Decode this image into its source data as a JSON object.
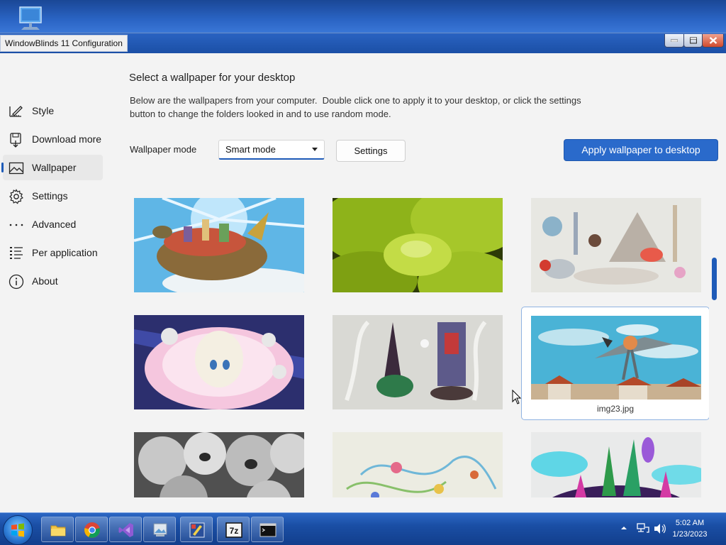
{
  "window": {
    "title": "WindowBlinds 11 Configuration"
  },
  "sidebar": {
    "items": [
      {
        "label": "Style",
        "icon": "pencil-ruler-icon"
      },
      {
        "label": "Download more",
        "icon": "floppy-download-icon"
      },
      {
        "label": "Wallpaper",
        "icon": "landscape-picture-icon",
        "selected": true
      },
      {
        "label": "Settings",
        "icon": "gear-icon"
      },
      {
        "label": "Advanced",
        "icon": "ellipsis-icon"
      },
      {
        "label": "Per application",
        "icon": "list-icon"
      },
      {
        "label": "About",
        "icon": "info-icon"
      }
    ]
  },
  "main": {
    "heading": "Select a wallpaper for your desktop",
    "description": "Below are the wallpapers from your computer.  Double click one to apply it to your desktop, or click the settings\nbutton to change the folders looked in and to use random mode.",
    "mode_label": "Wallpaper mode",
    "mode_value": "Smart mode",
    "settings_button": "Settings",
    "apply_button": "Apply wallpaper to desktop",
    "hovered_caption": "img23.jpg"
  },
  "taskbar": {
    "apps": [
      "file-explorer-icon",
      "chrome-icon",
      "visual-studio-icon",
      "image-viewer-icon",
      "paint-app-icon",
      "7zip-icon",
      "terminal-icon"
    ],
    "app_7zip_label": "7z",
    "time": "5:02 AM",
    "date": "1/23/2023"
  },
  "colors": {
    "accent": "#1e5bb8",
    "apply_button": "#2a6acb",
    "titlebar": "#1b4fa6",
    "taskbar": "#1a4ea4"
  }
}
